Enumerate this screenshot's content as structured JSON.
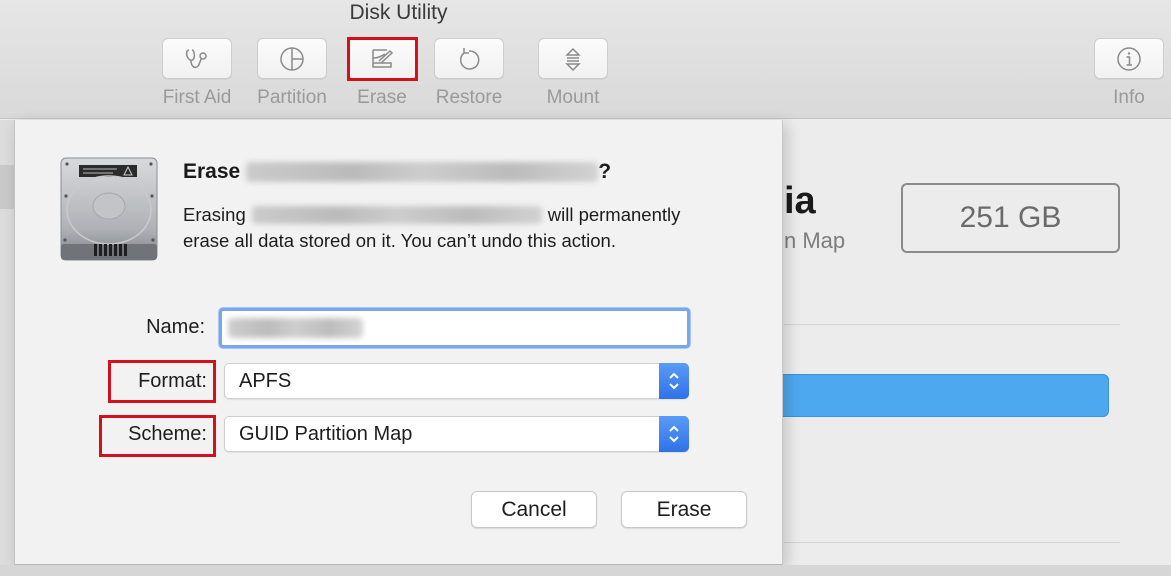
{
  "window": {
    "title": "Disk Utility"
  },
  "toolbar": {
    "items": [
      {
        "label": "First Aid",
        "icon": "stethoscope-icon"
      },
      {
        "label": "Partition",
        "icon": "pie-chart-icon"
      },
      {
        "label": "Erase",
        "icon": "erase-icon",
        "highlighted": true
      },
      {
        "label": "Restore",
        "icon": "restore-arrow-icon"
      },
      {
        "label": "Mount",
        "icon": "mount-arrows-icon"
      },
      {
        "label": "Info",
        "icon": "info-icon"
      }
    ]
  },
  "background": {
    "disk_title_fragment": "ia",
    "disk_subtitle_fragment": "n Map",
    "capacity": "251 GB",
    "usage_bar_color": "#4ea8ef"
  },
  "dialog": {
    "title_prefix": "Erase",
    "title_suffix": "?",
    "body_prefix": "Erasing",
    "body_suffix": "will permanently",
    "body_line2": "erase all data stored on it. You can’t undo this action.",
    "redacted_disk_name": "[redacted]",
    "fields": {
      "name_label": "Name:",
      "name_value": "[redacted]",
      "format_label": "Format:",
      "format_value": "APFS",
      "scheme_label": "Scheme:",
      "scheme_value": "GUID Partition Map"
    },
    "buttons": {
      "cancel": "Cancel",
      "erase": "Erase"
    }
  },
  "colors": {
    "highlight": "#d4101a",
    "focus_ring": "#7aa6ea",
    "stepper": "#3a80ee"
  }
}
